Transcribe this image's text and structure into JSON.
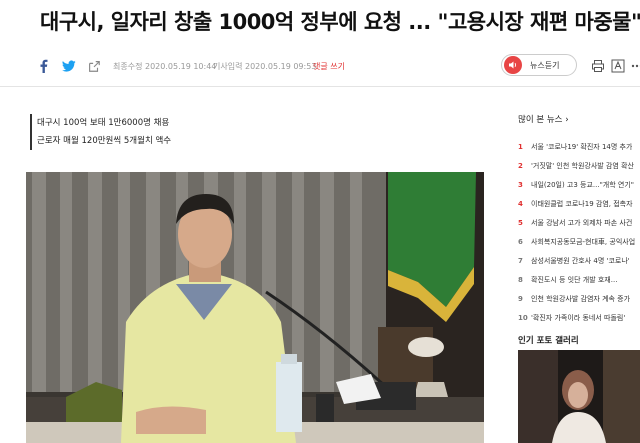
{
  "article": {
    "headline": "대구시, 일자리 창출 1000억 정부에 요청 ... \"고용시장 재편 마중물\"",
    "modified": "최종수정 2020.05.19 10:44",
    "published": "기사입력 2020.05.19 09:53",
    "reply_label": "댓글 쓰기",
    "summary": [
      "대구시 100억 보태 1만6000명 채용",
      "근로자 매월 120만원씩 5개월치 액수"
    ]
  },
  "toolbar": {
    "news_listen_label": "뉴스듣기",
    "icons": [
      "facebook-icon",
      "twitter-icon",
      "share-icon",
      "speaker-icon",
      "print-icon",
      "font-size-icon",
      "more-icon"
    ]
  },
  "sidebar": {
    "popular_title": "많이 본 뉴스 ›",
    "popular": [
      {
        "rank": "1",
        "text": "서울 '코로나19' 확진자 14명 추가"
      },
      {
        "rank": "2",
        "text": "'거짓말' 인천 학원강사발 감염 확산"
      },
      {
        "rank": "3",
        "text": "내일(20일) 고3 등교...\"개학 연기\""
      },
      {
        "rank": "4",
        "text": "이태원클럽 코로나19 감염, 접촉자"
      },
      {
        "rank": "5",
        "text": "서울 강남서 고가 외제차 파손 사건"
      },
      {
        "rank": "6",
        "text": "사회복지공동모금-현대車, 공익사업"
      },
      {
        "rank": "7",
        "text": "삼성서울병원 간호사 4명 '코로나'"
      },
      {
        "rank": "8",
        "text": "확진도시 등 잇단 개발 호재..."
      },
      {
        "rank": "9",
        "text": "인천 학원강사발 감염자 계속 증가"
      },
      {
        "rank": "10",
        "text": "'확진자 가족이라 동네서 따돌림'"
      }
    ],
    "gallery_title": "인기 포토 갤러리"
  },
  "colors": {
    "accent": "#e03030",
    "facebook": "#3b5998",
    "twitter": "#1da1f2"
  }
}
